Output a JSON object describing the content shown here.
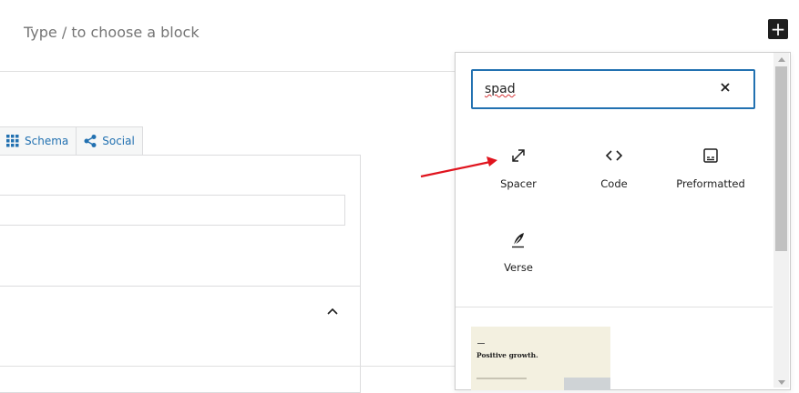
{
  "editor": {
    "placeholder": "Type / to choose a block",
    "add_block_symbol": "+"
  },
  "meta_box": {
    "tabs": [
      {
        "label": "Schema",
        "icon": "grid-icon"
      },
      {
        "label": "Social",
        "icon": "share-icon"
      }
    ]
  },
  "inserter": {
    "search": {
      "value": "spad"
    },
    "blocks": [
      {
        "label": "Spacer",
        "icon": "resize-icon"
      },
      {
        "label": "Code",
        "icon": "code-icon"
      },
      {
        "label": "Preformatted",
        "icon": "preformatted-icon"
      },
      {
        "label": "Verse",
        "icon": "feather-icon"
      }
    ],
    "pattern": {
      "title": "Positive growth."
    }
  },
  "colors": {
    "accent": "#2271b1",
    "annotation_arrow": "#e0141e",
    "pattern_background": "#f3f0e0"
  }
}
